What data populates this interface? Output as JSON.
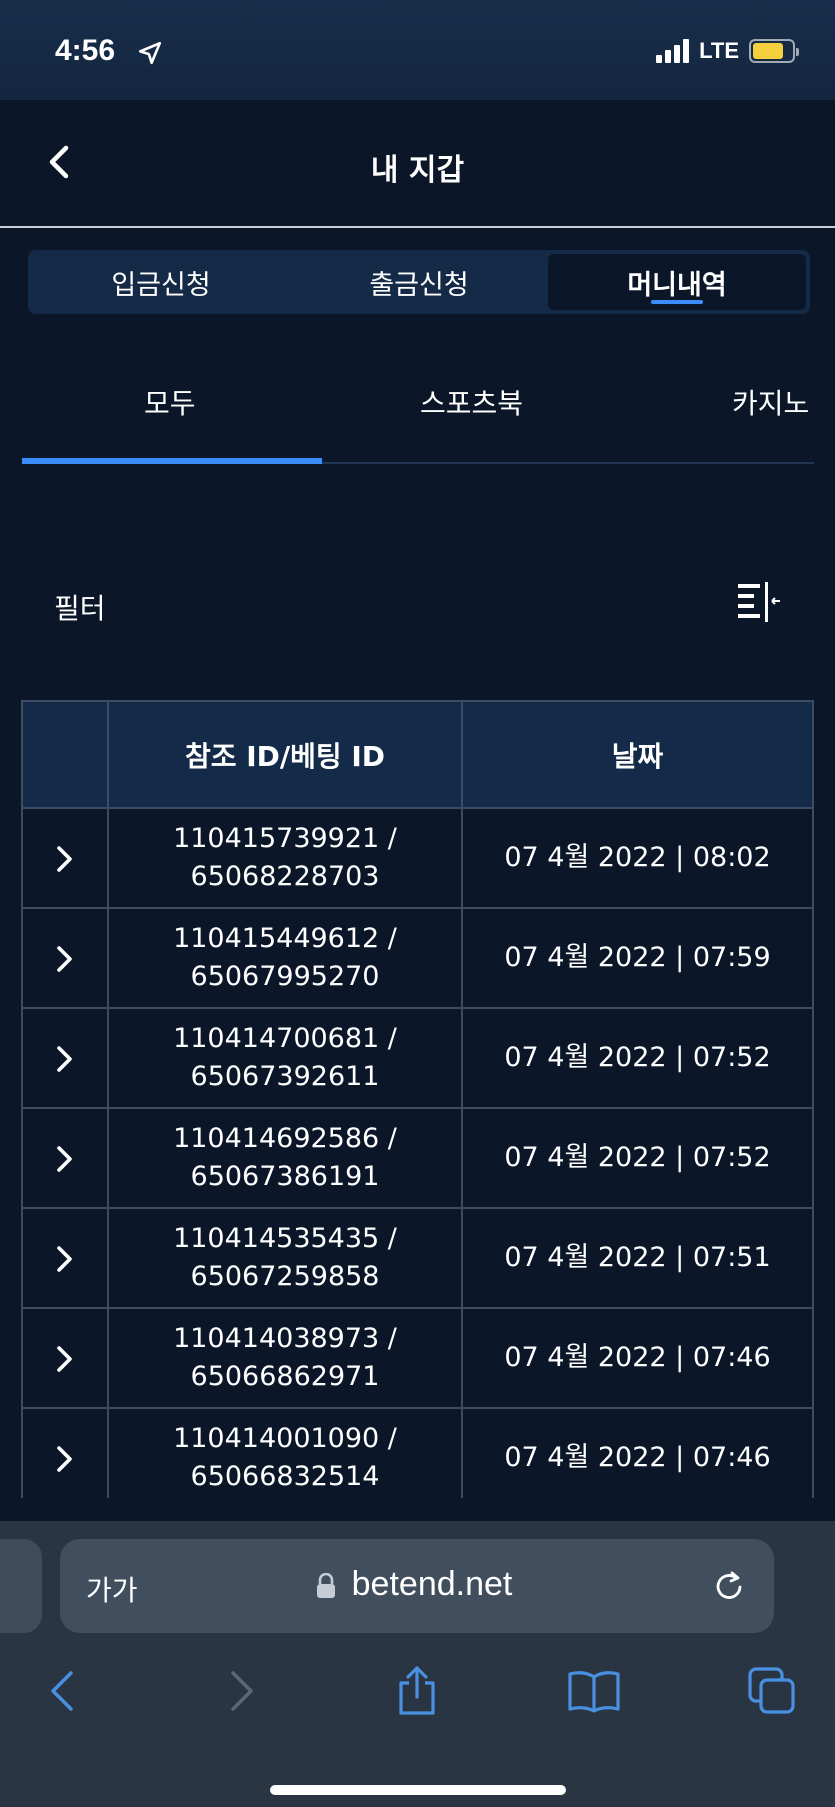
{
  "status": {
    "time": "4:56",
    "network": "LTE",
    "battery_color": "#f4d03f"
  },
  "header": {
    "title": "내 지갑",
    "back_icon": "chevron-left-icon"
  },
  "segment_tabs": [
    {
      "label": "입금신청",
      "active": false
    },
    {
      "label": "출금신청",
      "active": false
    },
    {
      "label": "머니내역",
      "active": true
    }
  ],
  "sub_tabs": [
    {
      "label": "모두",
      "active": true
    },
    {
      "label": "스포츠북",
      "active": false
    },
    {
      "label": "카지노",
      "active": false
    }
  ],
  "filter": {
    "label": "필터",
    "icon": "filter-sort-icon"
  },
  "table": {
    "headers": [
      "",
      "참조 ID/베팅 ID",
      "날짜"
    ],
    "rows": [
      {
        "ref_id": "110415739921 /",
        "bet_id": "65068228703",
        "date": "07 4월 2022 | 08:02"
      },
      {
        "ref_id": "110415449612 /",
        "bet_id": "65067995270",
        "date": "07 4월 2022 | 07:59"
      },
      {
        "ref_id": "110414700681 /",
        "bet_id": "65067392611",
        "date": "07 4월 2022 | 07:52"
      },
      {
        "ref_id": "110414692586 /",
        "bet_id": "65067386191",
        "date": "07 4월 2022 | 07:52"
      },
      {
        "ref_id": "110414535435 /",
        "bet_id": "65067259858",
        "date": "07 4월 2022 | 07:51"
      },
      {
        "ref_id": "110414038973 /",
        "bet_id": "65066862971",
        "date": "07 4월 2022 | 07:46"
      },
      {
        "ref_id": "110414001090 /",
        "bet_id": "65066832514",
        "date": "07 4월 2022 | 07:46"
      },
      {
        "ref_id": "",
        "bet_id": "",
        "date": ""
      }
    ]
  },
  "browser": {
    "text_size": "가가",
    "url": "betend.net"
  },
  "colors": {
    "accent": "#3a8dff",
    "background": "#0b1628",
    "header_cell": "#132a48",
    "browser_accent": "#4a90e2"
  }
}
